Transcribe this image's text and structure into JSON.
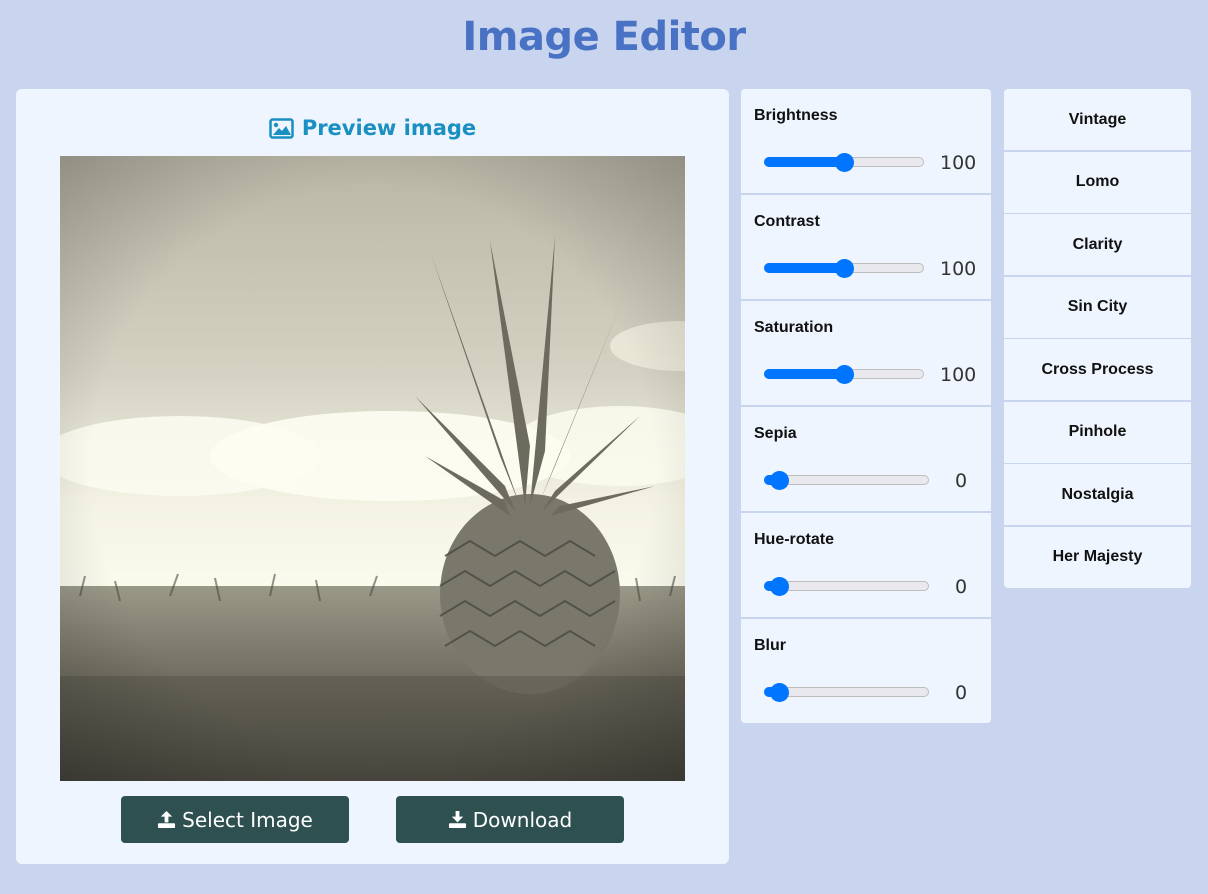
{
  "app": {
    "title": "Image Editor"
  },
  "preview": {
    "header": "Preview image",
    "image_icon": "image-icon",
    "select_label": "Select Image",
    "download_label": "Download"
  },
  "adjustments": [
    {
      "label": "Brightness",
      "value": "100",
      "level": 0.5
    },
    {
      "label": "Contrast",
      "value": "100",
      "level": 0.5
    },
    {
      "label": "Saturation",
      "value": "100",
      "level": 0.5
    },
    {
      "label": "Sepia",
      "value": "0",
      "level": 0
    },
    {
      "label": "Hue-rotate",
      "value": "0",
      "level": 0
    },
    {
      "label": "Blur",
      "value": "0",
      "level": 0
    }
  ],
  "filters": [
    "Vintage",
    "Lomo",
    "Clarity",
    "Sin City",
    "Cross Process",
    "Pinhole",
    "Nostalgia",
    "Her Majesty"
  ],
  "colors": {
    "background": "#c9d5ee",
    "title": "#4a72c4",
    "accent": "#0075ff",
    "button": "#2e5050",
    "panel": "#eef5fe"
  }
}
